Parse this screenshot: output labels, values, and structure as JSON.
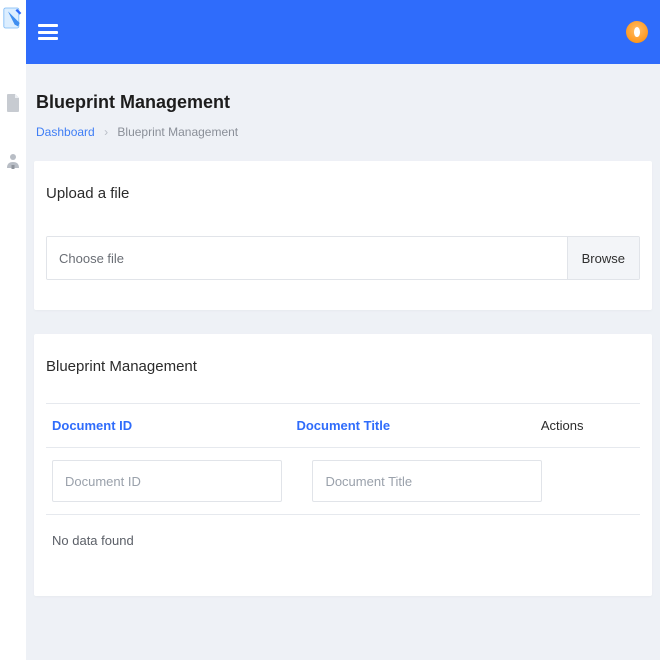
{
  "header": {
    "avatar_alt": "User avatar"
  },
  "sidebar": {
    "items": [
      {
        "name": "documents",
        "icon": "document-icon"
      },
      {
        "name": "users",
        "icon": "user-icon"
      }
    ]
  },
  "page": {
    "title": "Blueprint Management",
    "breadcrumb": {
      "root_label": "Dashboard",
      "current_label": "Blueprint Management"
    }
  },
  "upload_card": {
    "title": "Upload a file",
    "choose_label": "Choose file",
    "browse_label": "Browse"
  },
  "table_card": {
    "title": "Blueprint Management",
    "columns": {
      "id": "Document ID",
      "title": "Document Title",
      "actions": "Actions"
    },
    "filters": {
      "id_placeholder": "Document ID",
      "title_placeholder": "Document Title"
    },
    "empty_text": "No data found"
  }
}
